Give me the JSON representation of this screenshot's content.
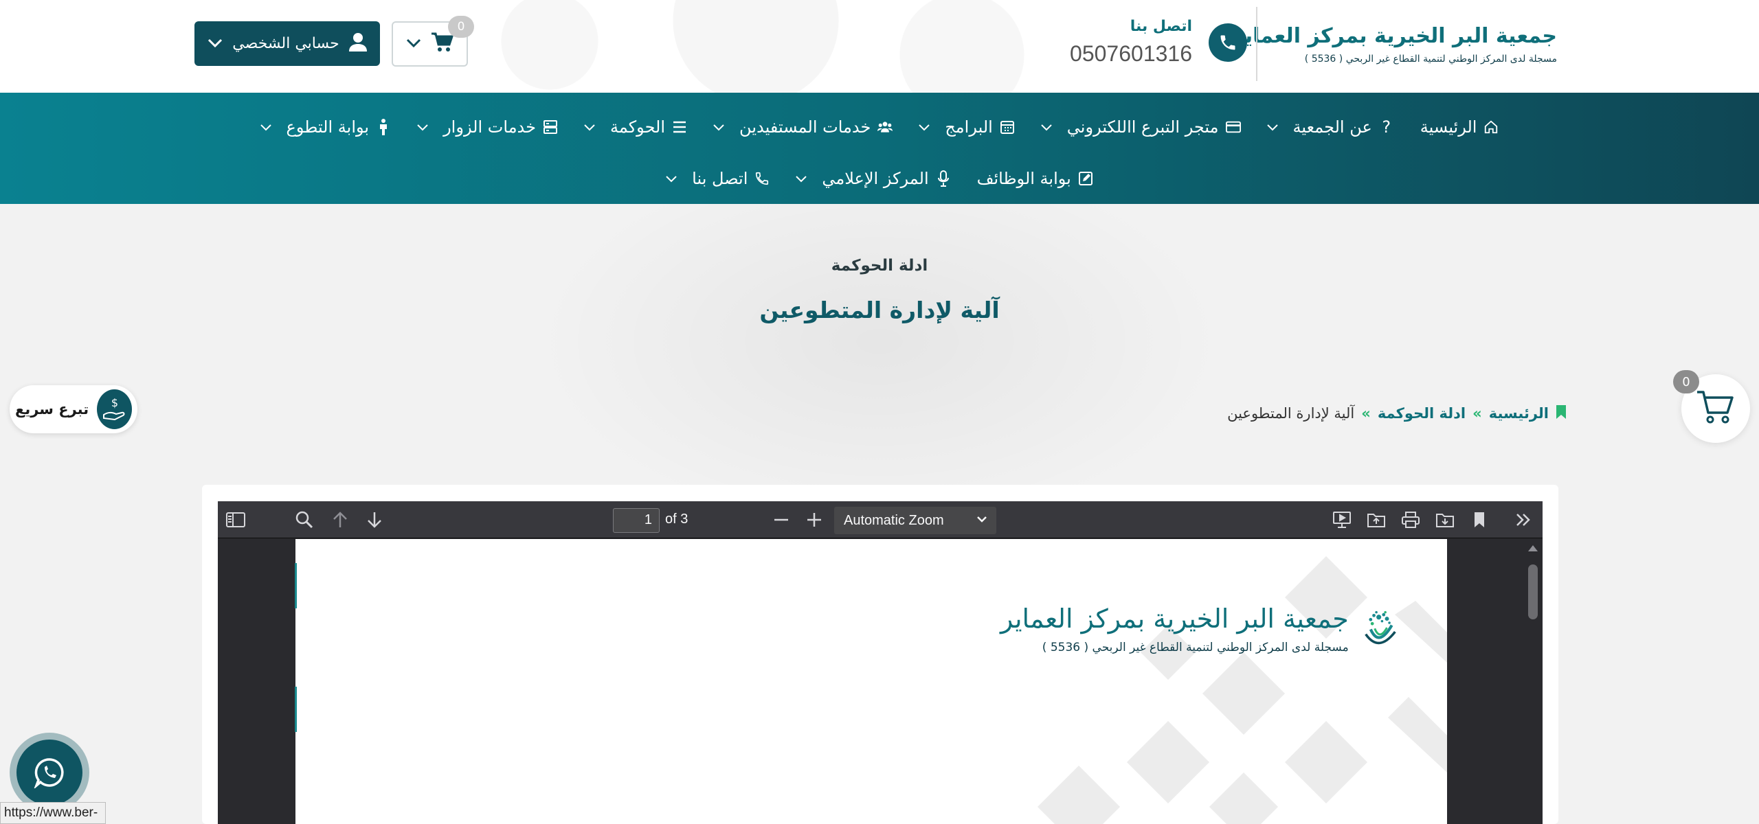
{
  "header": {
    "logo": {
      "title": "جمعية البر الخيرية بمركز العماير",
      "subtitle": "مسجلة لدى المركز الوطني لتنمية القطاع غير الربحي ( 5536 )"
    },
    "contact": {
      "label": "اتصل بنا",
      "phone": "0507601316"
    },
    "account_label": "حسابي الشخصي",
    "cart_count": "0"
  },
  "nav": {
    "row1": [
      {
        "label": "الرئيسية",
        "icon": "home-icon"
      },
      {
        "label": "عن الجمعية",
        "icon": "question-icon"
      },
      {
        "label": "متجر التبرع االلكتروني",
        "icon": "card-icon"
      },
      {
        "label": "البرامج",
        "icon": "calendar-icon"
      },
      {
        "label": "خدمات المستفيدين",
        "icon": "users-icon"
      },
      {
        "label": "الحوكمة",
        "icon": "list-icon"
      },
      {
        "label": "خدمات الزوار",
        "icon": "server-icon"
      },
      {
        "label": "بوابة التطوع",
        "icon": "person-icon"
      }
    ],
    "row2": [
      {
        "label": "بوابة الوظائف",
        "icon": "edit-icon"
      },
      {
        "label": "المركز الإعلامي",
        "icon": "microphone-icon"
      },
      {
        "label": "اتصل بنا",
        "icon": "phone-icon"
      }
    ]
  },
  "hero": {
    "subtitle": "ادلة الحوكمة",
    "title": "آلية لإدارة المتطوعين"
  },
  "breadcrumb": {
    "home": "الرئيسية",
    "section": "ادلة الحوكمة",
    "current": "آلية لإدارة المتطوعين",
    "separator": "»"
  },
  "quick_donate_label": "تبرع سريع",
  "floating_cart_count": "0",
  "status_url": "https://www.ber-",
  "pdf_viewer": {
    "page_number": "1",
    "page_total_text": "of 3",
    "zoom": "Automatic Zoom"
  },
  "colors": {
    "brand_dark": "#0f4e5c",
    "brand_teal": "#0f6f7a",
    "accent_green": "#2bb673",
    "nav_start": "#0a8190",
    "nav_end": "#0f4654"
  }
}
